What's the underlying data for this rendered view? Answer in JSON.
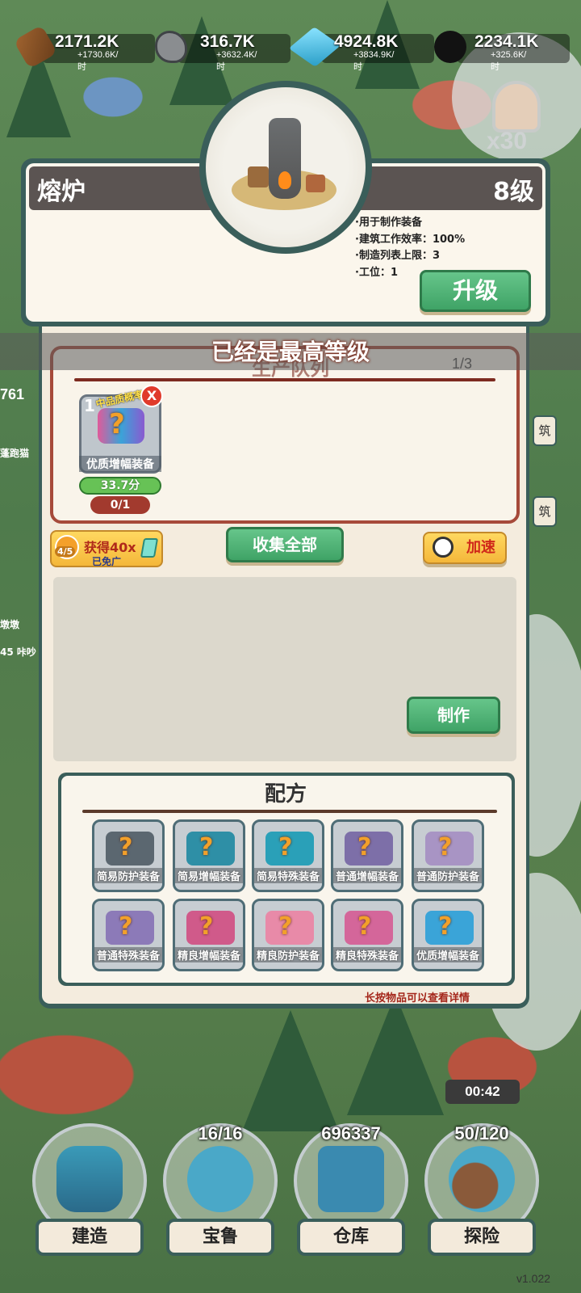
{
  "resources": [
    {
      "icon": "wood-icon",
      "value": "2171.2K",
      "rate": "+1730.6K/时"
    },
    {
      "icon": "stone-icon",
      "value": "316.7K",
      "rate": "+3632.4K/时"
    },
    {
      "icon": "crystal-icon",
      "value": "4924.8K",
      "rate": "+3834.9K/时"
    },
    {
      "icon": "coal-icon",
      "value": "2234.1K",
      "rate": "+325.6K/时"
    }
  ],
  "multiplier": "x30",
  "building": {
    "name": "熔炉",
    "level": "8级",
    "info": [
      "·用于制作装备",
      "·建筑工作效率：100%",
      "·制造列表上限：3",
      "·工位：1"
    ],
    "upgrade_label": "升级"
  },
  "max_level_banner": "已经是最高等级",
  "queue": {
    "title": "生产队列",
    "count": "1/3",
    "slot": {
      "index": "1",
      "tag": "中品质概率↑",
      "name": "优质增幅装备",
      "time": "33.7分",
      "progress": "0/1",
      "close": "X"
    }
  },
  "ad_button": {
    "count": "4/5",
    "label": "获得40x",
    "sub": "已免广"
  },
  "collect_label": "收集全部",
  "speed_label": "加速",
  "make_label": "制作",
  "recipes": {
    "title": "配方",
    "items": [
      {
        "name": "简易防护装备",
        "color": "#5b6770"
      },
      {
        "name": "简易增幅装备",
        "color": "#2e8fa6"
      },
      {
        "name": "简易特殊装备",
        "color": "#2aa0b8"
      },
      {
        "name": "普通增幅装备",
        "color": "#7d6fa8"
      },
      {
        "name": "普通防护装备",
        "color": "#a894c4"
      },
      {
        "name": "普通特殊装备",
        "color": "#8c7ab8"
      },
      {
        "name": "精良增幅装备",
        "color": "#d05a8a"
      },
      {
        "name": "精良防护装备",
        "color": "#e88aa8"
      },
      {
        "name": "精良特殊装备",
        "color": "#d4669a"
      },
      {
        "name": "优质增幅装备",
        "color": "#3aa4d8"
      }
    ],
    "hint": "长按物品可以查看详情"
  },
  "nav": [
    {
      "label": "建造",
      "badge": ""
    },
    {
      "label": "宝鲁",
      "badge": "16/16"
    },
    {
      "label": "仓库",
      "badge": "696337"
    },
    {
      "label": "探险",
      "badge": "50/120"
    }
  ],
  "timer": "00:42",
  "side_tabs": [
    "筑",
    "筑"
  ],
  "left_labels": {
    "level_num": "761",
    "pet1": "蓬跑猫",
    "pet2": "墩墩",
    "pet3": "45 咔吵"
  },
  "version": "v1.022"
}
